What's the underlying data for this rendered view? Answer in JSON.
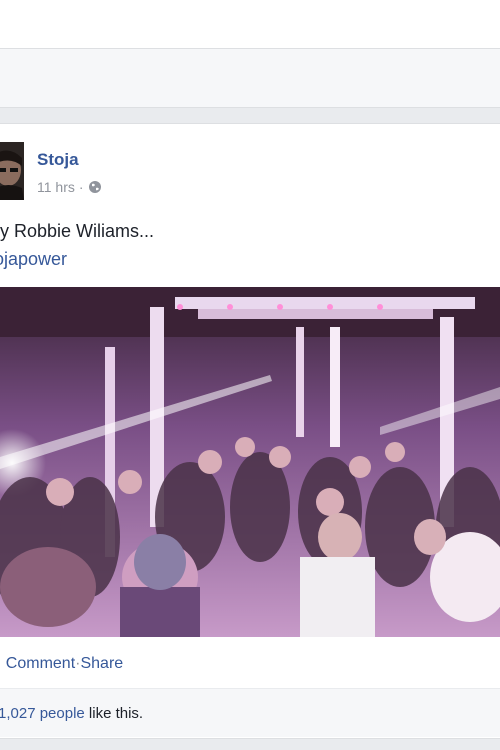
{
  "post": {
    "author": "Stoja",
    "time": "11 hrs",
    "privacy_icon": "globe-icon",
    "text": "ry Robbie Wiliams...",
    "hashtag": "ojapower",
    "image_subject": "nightclub-crowd-photo",
    "actions": {
      "comment": "Comment",
      "separator": "·",
      "share": "Share"
    },
    "likes": {
      "count": "1,027 people",
      "suffix": " like this."
    }
  },
  "colors": {
    "link_blue": "#365899",
    "meta_gray": "#90949c",
    "page_bg": "#e9ebee"
  }
}
